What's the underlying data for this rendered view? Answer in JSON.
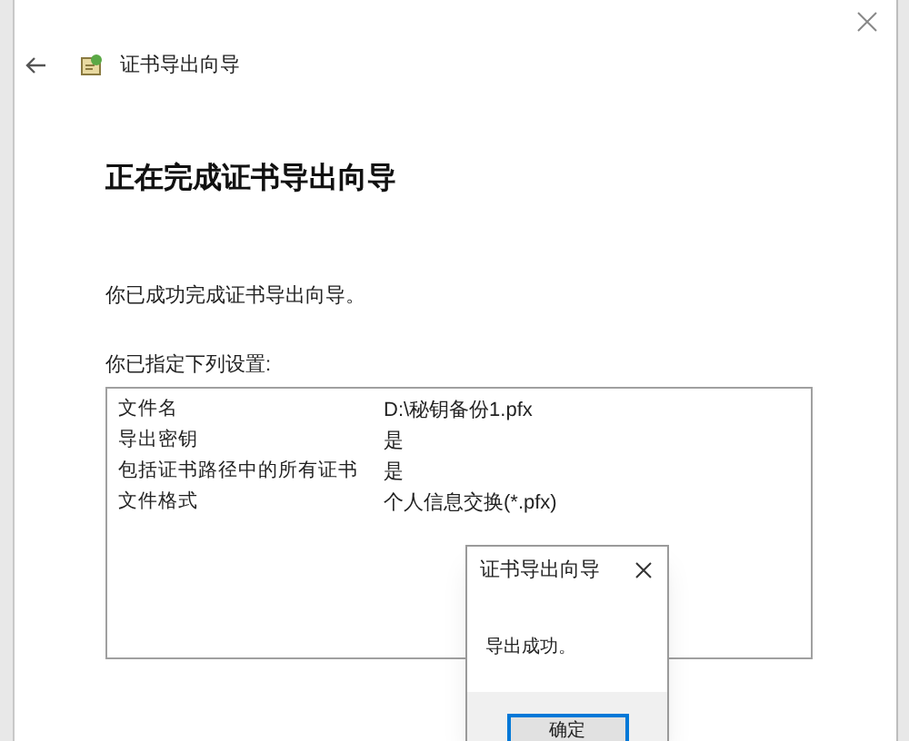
{
  "window": {
    "title": "证书导出向导"
  },
  "heading": "正在完成证书导出向导",
  "message": "你已成功完成证书导出向导。",
  "settings_label": "你已指定下列设置:",
  "settings": [
    {
      "name": "文件名",
      "value": "D:\\秘钥备份1.pfx"
    },
    {
      "name": "导出密钥",
      "value": "是"
    },
    {
      "name": "包括证书路径中的所有证书",
      "value": "是"
    },
    {
      "name": "文件格式",
      "value": "个人信息交换(*.pfx)"
    }
  ],
  "dialog": {
    "title": "证书导出向导",
    "message": "导出成功。",
    "button": "确定"
  }
}
